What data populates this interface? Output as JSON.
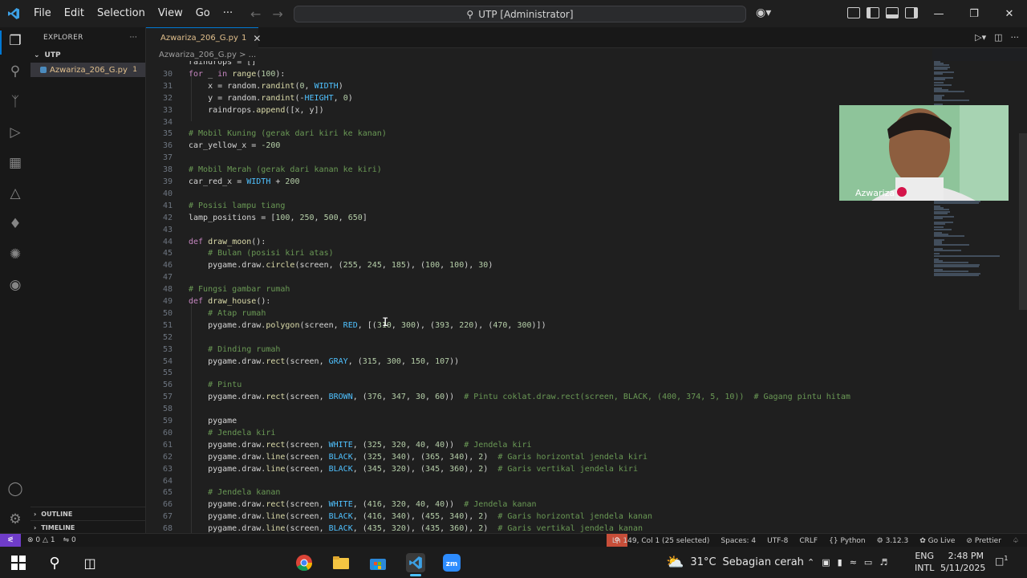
{
  "menu": [
    "File",
    "Edit",
    "Selection",
    "View",
    "Go",
    "···"
  ],
  "command_center": "UTP [Administrator]",
  "sidebar": {
    "title": "EXPLORER",
    "folder": "UTP",
    "file": "Azwariza_206_G.py",
    "file_badge": "1",
    "outline": "OUTLINE",
    "timeline": "TIMELINE"
  },
  "tab": {
    "label": "Azwariza_206_G.py",
    "badge": "1"
  },
  "breadcrumb": "Azwariza_206_G.py > ...",
  "code": [
    {
      "n": "",
      "t": "raindrops = []"
    },
    {
      "n": "30",
      "t": "for _ in range(100):"
    },
    {
      "n": "31",
      "t": "    x = random.randint(0, WIDTH)"
    },
    {
      "n": "32",
      "t": "    y = random.randint(-HEIGHT, 0)"
    },
    {
      "n": "33",
      "t": "    raindrops.append([x, y])"
    },
    {
      "n": "34",
      "t": ""
    },
    {
      "n": "35",
      "t": "# Mobil Kuning (gerak dari kiri ke kanan)"
    },
    {
      "n": "36",
      "t": "car_yellow_x = -200"
    },
    {
      "n": "37",
      "t": ""
    },
    {
      "n": "38",
      "t": "# Mobil Merah (gerak dari kanan ke kiri)"
    },
    {
      "n": "39",
      "t": "car_red_x = WIDTH + 200"
    },
    {
      "n": "40",
      "t": ""
    },
    {
      "n": "41",
      "t": "# Posisi lampu tiang"
    },
    {
      "n": "42",
      "t": "lamp_positions = [100, 250, 500, 650]"
    },
    {
      "n": "43",
      "t": ""
    },
    {
      "n": "44",
      "t": "def draw_moon():"
    },
    {
      "n": "45",
      "t": "    # Bulan (posisi kiri atas)"
    },
    {
      "n": "46",
      "t": "    pygame.draw.circle(screen, (255, 245, 185), (100, 100), 30)"
    },
    {
      "n": "47",
      "t": ""
    },
    {
      "n": "48",
      "t": "# Fungsi gambar rumah"
    },
    {
      "n": "49",
      "t": "def draw_house():"
    },
    {
      "n": "50",
      "t": "    # Atap rumah"
    },
    {
      "n": "51",
      "t": "    pygame.draw.polygon(screen, RED, [(310, 300), (393, 220), (470, 300)])"
    },
    {
      "n": "52",
      "t": ""
    },
    {
      "n": "53",
      "t": "    # Dinding rumah"
    },
    {
      "n": "54",
      "t": "    pygame.draw.rect(screen, GRAY, (315, 300, 150, 107))"
    },
    {
      "n": "55",
      "t": ""
    },
    {
      "n": "56",
      "t": "    # Pintu"
    },
    {
      "n": "57",
      "t": "    pygame.draw.rect(screen, BROWN, (376, 347, 30, 60))  # Pintu coklat.draw.rect(screen, BLACK, (400, 374, 5, 10))  # Gagang pintu hitam"
    },
    {
      "n": "58",
      "t": ""
    },
    {
      "n": "59",
      "t": "    pygame"
    },
    {
      "n": "60",
      "t": "    # Jendela kiri"
    },
    {
      "n": "61",
      "t": "    pygame.draw.rect(screen, WHITE, (325, 320, 40, 40))  # Jendela kiri"
    },
    {
      "n": "62",
      "t": "    pygame.draw.line(screen, BLACK, (325, 340), (365, 340), 2)  # Garis horizontal jendela kiri"
    },
    {
      "n": "63",
      "t": "    pygame.draw.line(screen, BLACK, (345, 320), (345, 360), 2)  # Garis vertikal jendela kiri"
    },
    {
      "n": "64",
      "t": ""
    },
    {
      "n": "65",
      "t": "    # Jendela kanan"
    },
    {
      "n": "66",
      "t": "    pygame.draw.rect(screen, WHITE, (416, 320, 40, 40))  # Jendela kanan"
    },
    {
      "n": "67",
      "t": "    pygame.draw.line(screen, BLACK, (416, 340), (455, 340), 2)  # Garis horizontal jendela kanan"
    },
    {
      "n": "68",
      "t": "    pygame.draw.line(screen, BLACK, (435, 320), (435, 360), 2)  # Garis vertikal jendela kanan"
    }
  ],
  "webcam": {
    "name": "Azwariza"
  },
  "status": {
    "errors": "0",
    "warnings": "1",
    "ports": "0",
    "position": "Ln 149, Col 1 (25 selected)",
    "spaces": "Spaces: 4",
    "encoding": "UTF-8",
    "eol": "CRLF",
    "language": "Python",
    "version": "3.12.3",
    "golive": "Go Live",
    "prettier": "Prettier"
  },
  "taskbar": {
    "temperature": "31°C",
    "weather": "Sebagian cerah",
    "lang1": "ENG",
    "lang2": "INTL",
    "time": "2:48 PM",
    "date": "5/11/2025",
    "notifications": "1"
  },
  "colors": {
    "keyword": "#c586c0",
    "function": "#dcdcaa",
    "string_num": "#b5cea8",
    "comment": "#6a9955",
    "constant": "#4fc1ff",
    "accent": "#0078d4"
  }
}
